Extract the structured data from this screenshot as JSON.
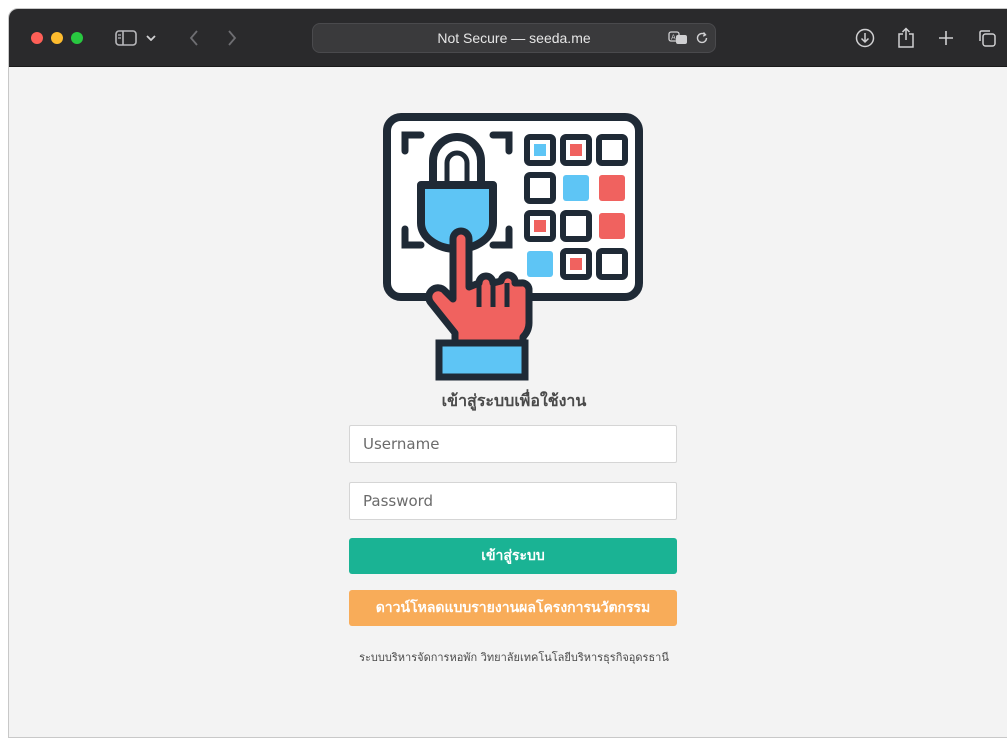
{
  "browser": {
    "address": "Not Secure — seeda.me",
    "icons": [
      "sidebar-icon",
      "chevron-down-icon",
      "back-icon",
      "forward-icon",
      "translate-icon",
      "reload-icon",
      "download-icon",
      "share-icon",
      "new-tab-icon",
      "tab-overview-icon"
    ]
  },
  "login": {
    "title": "เข้าสู่ระบบเพื่อใช้งาน",
    "username_placeholder": "Username",
    "password_placeholder": "Password",
    "login_button": "เข้าสู่ระบบ",
    "download_button": "ดาวน์โหลดแบบรายงานผลโครงการนวัตกรรม",
    "footer": "ระบบบริหารจัดการหอพัก วิทยาลัยเทคโนโลยีบริหารธุรกิจอุดรธานี"
  },
  "colors": {
    "login_button": "#1ab394",
    "download_button": "#f8ac59",
    "hero_blue": "#5ec5f5",
    "hero_red": "#f0625f",
    "hero_outline": "#1f2a36"
  }
}
